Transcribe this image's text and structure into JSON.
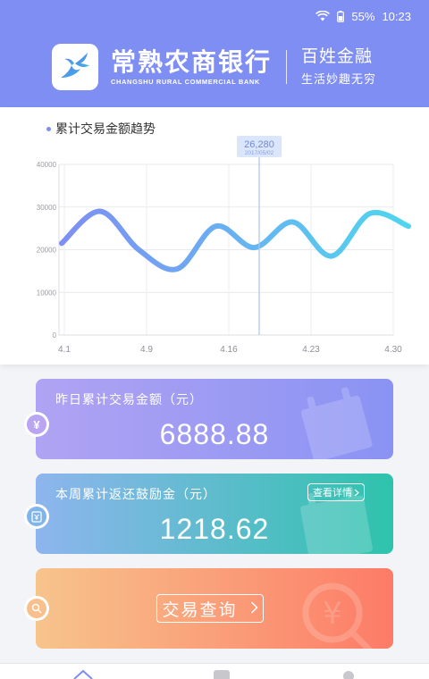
{
  "status_bar": {
    "battery": "55%",
    "time": "10:23",
    "icons": [
      "wifi-icon",
      "battery-icon"
    ]
  },
  "header": {
    "bank_name_cn": "常熟农商银行",
    "bank_name_en": "CHANGSHU RURAL COMMERCIAL BANK",
    "slogan_main": "百姓金融",
    "slogan_sub": "生活妙趣无穷",
    "bg_color": "#7f8ef3"
  },
  "chart_data": {
    "type": "line",
    "title": "累计交易金额趋势",
    "x_ticks": [
      "4.1",
      "4.9",
      "4.16",
      "4.23",
      "4.30"
    ],
    "y_ticks": [
      "0",
      "10000",
      "20000",
      "30000",
      "40000"
    ],
    "ylim": [
      0,
      40000
    ],
    "grid": true,
    "x": [
      "4.1",
      "4.5",
      "4.9",
      "4.12",
      "4.16",
      "4.19",
      "4.23",
      "4.26",
      "4.30",
      "5.1"
    ],
    "values": [
      21500,
      29000,
      20000,
      15500,
      25500,
      20500,
      26500,
      18500,
      28500,
      25500
    ],
    "tooltip": {
      "value": "26,280",
      "date": "2017/05/02"
    },
    "line_gradient": [
      "#7f8ef3",
      "#4fd6ee"
    ]
  },
  "cards": {
    "yesterday": {
      "label": "昨日累计交易金额（元）",
      "value": "6888.88",
      "icon": "yen-icon"
    },
    "weekly": {
      "label": "本周累计返还鼓励金（元）",
      "value": "1218.62",
      "details": "查看详情",
      "icon": "wallet-icon"
    },
    "query": {
      "button": "交易查询",
      "icon": "search-icon"
    }
  },
  "bottom_nav": {
    "icons": [
      "home-icon",
      "document-icon",
      "user-icon"
    ]
  }
}
